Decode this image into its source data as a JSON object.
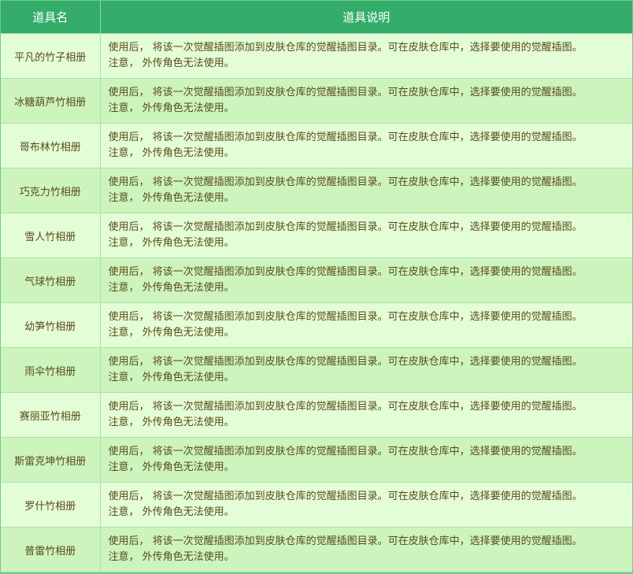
{
  "header": {
    "col_name": "道具名",
    "col_desc": "道具说明"
  },
  "rows": [
    {
      "name": "平凡的竹子相册",
      "desc_line1": "使用后， 将该一次觉醒插图添加到皮肤仓库的觉醒插图目录。可在皮肤仓库中，选择要使用的觉醒插图。",
      "desc_line2": "注意， 外传角色无法使用。"
    },
    {
      "name": "冰糖葫芦竹相册",
      "desc_line1": "使用后， 将该一次觉醒插图添加到皮肤仓库的觉醒插图目录。可在皮肤仓库中，选择要使用的觉醒插图。",
      "desc_line2": "注意， 外传角色无法使用。"
    },
    {
      "name": "哥布林竹相册",
      "desc_line1": "使用后， 将该一次觉醒插图添加到皮肤仓库的觉醒插图目录。可在皮肤仓库中，选择要使用的觉醒插图。",
      "desc_line2": "注意， 外传角色无法使用。"
    },
    {
      "name": "巧克力竹相册",
      "desc_line1": "使用后， 将该一次觉醒插图添加到皮肤仓库的觉醒插图目录。可在皮肤仓库中，选择要使用的觉醒插图。",
      "desc_line2": "注意， 外传角色无法使用。"
    },
    {
      "name": "雪人竹相册",
      "desc_line1": "使用后， 将该一次觉醒插图添加到皮肤仓库的觉醒插图目录。可在皮肤仓库中，选择要使用的觉醒插图。",
      "desc_line2": "注意， 外传角色无法使用。"
    },
    {
      "name": "气球竹相册",
      "desc_line1": "使用后， 将该一次觉醒插图添加到皮肤仓库的觉醒插图目录。可在皮肤仓库中，选择要使用的觉醒插图。",
      "desc_line2": "注意， 外传角色无法使用。"
    },
    {
      "name": "幼笋竹相册",
      "desc_line1": "使用后， 将该一次觉醒插图添加到皮肤仓库的觉醒插图目录。可在皮肤仓库中，选择要使用的觉醒插图。",
      "desc_line2": "注意， 外传角色无法使用。"
    },
    {
      "name": "雨伞竹相册",
      "desc_line1": "使用后， 将该一次觉醒插图添加到皮肤仓库的觉醒插图目录。可在皮肤仓库中，选择要使用的觉醒插图。",
      "desc_line2": "注意， 外传角色无法使用。"
    },
    {
      "name": "赛丽亚竹相册",
      "desc_line1": "使用后， 将该一次觉醒插图添加到皮肤仓库的觉醒插图目录。可在皮肤仓库中，选择要使用的觉醒插图。",
      "desc_line2": "注意， 外传角色无法使用。"
    },
    {
      "name": "斯雷克坤竹相册",
      "desc_line1": "使用后， 将该一次觉醒插图添加到皮肤仓库的觉醒插图目录。可在皮肤仓库中，选择要使用的觉醒插图。",
      "desc_line2": "注意， 外传角色无法使用。"
    },
    {
      "name": "罗什竹相册",
      "desc_line1": "使用后， 将该一次觉醒插图添加到皮肤仓库的觉醒插图目录。可在皮肤仓库中，选择要使用的觉醒插图。",
      "desc_line2": "注意， 外传角色无法使用。"
    },
    {
      "name": "普雷竹相册",
      "desc_line1": "使用后， 将该一次觉醒插图添加到皮肤仓库的觉醒插图目录。可在皮肤仓库中，选择要使用的觉醒插图。",
      "desc_line2": "注意， 外传角色无法使用。"
    }
  ],
  "colors": {
    "header_bg": "#35ad6a",
    "row_light": "#e3fdd6",
    "row_dark": "#ccf4bc",
    "text": "#5a4a1a"
  }
}
